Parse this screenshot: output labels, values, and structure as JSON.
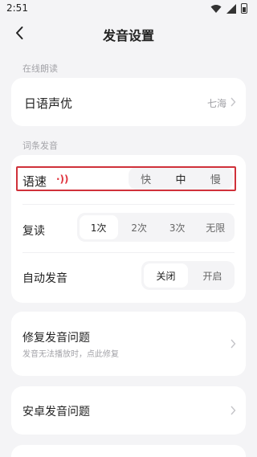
{
  "status_bar": {
    "time": "2:51"
  },
  "header": {
    "title": "发音设置"
  },
  "sections": {
    "online_reading": "在线朗读",
    "entry_pronunciation": "词条发音"
  },
  "japanese_voice": {
    "label": "日语声优",
    "value": "七海"
  },
  "speed": {
    "label": "语速",
    "indicator": "·))",
    "options": [
      "快",
      "中",
      "慢"
    ]
  },
  "repeat": {
    "label": "复读",
    "options": [
      "1次",
      "2次",
      "3次",
      "无限"
    ],
    "selected": "1次"
  },
  "auto_play": {
    "label": "自动发音",
    "options": [
      "关闭",
      "开启"
    ],
    "selected": "关闭"
  },
  "fix_issue": {
    "title": "修复发音问题",
    "subtitle": "发音无法播放时，点此修复"
  },
  "android_issue": {
    "title": "安卓发音问题"
  }
}
